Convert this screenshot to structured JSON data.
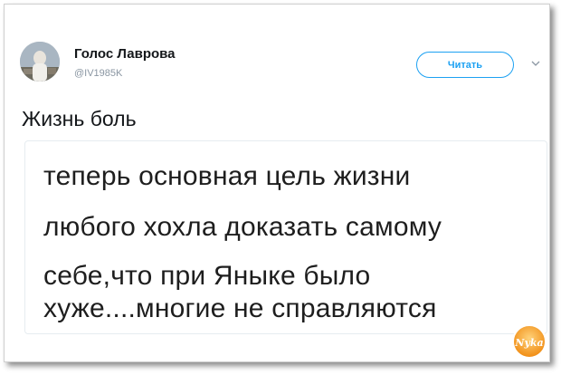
{
  "author": {
    "display_name": "Голос Лаврова",
    "handle": "@IV1985K"
  },
  "follow_button": {
    "label": "Читать"
  },
  "tweet": {
    "text": "Жизнь боль"
  },
  "quoted_image": {
    "lines": [
      "теперь основная цель жизни",
      "любого хохла доказать самому",
      "себе,что при Яныке было",
      "хуже....многие не справляются"
    ]
  },
  "watermark": {
    "text": "Nyka"
  },
  "colors": {
    "accent": "#1da1f2",
    "text": "#14171a",
    "muted": "#8a96a2",
    "watermark": "#f39a1c"
  },
  "icons": {
    "menu": "chevron-down-icon"
  }
}
